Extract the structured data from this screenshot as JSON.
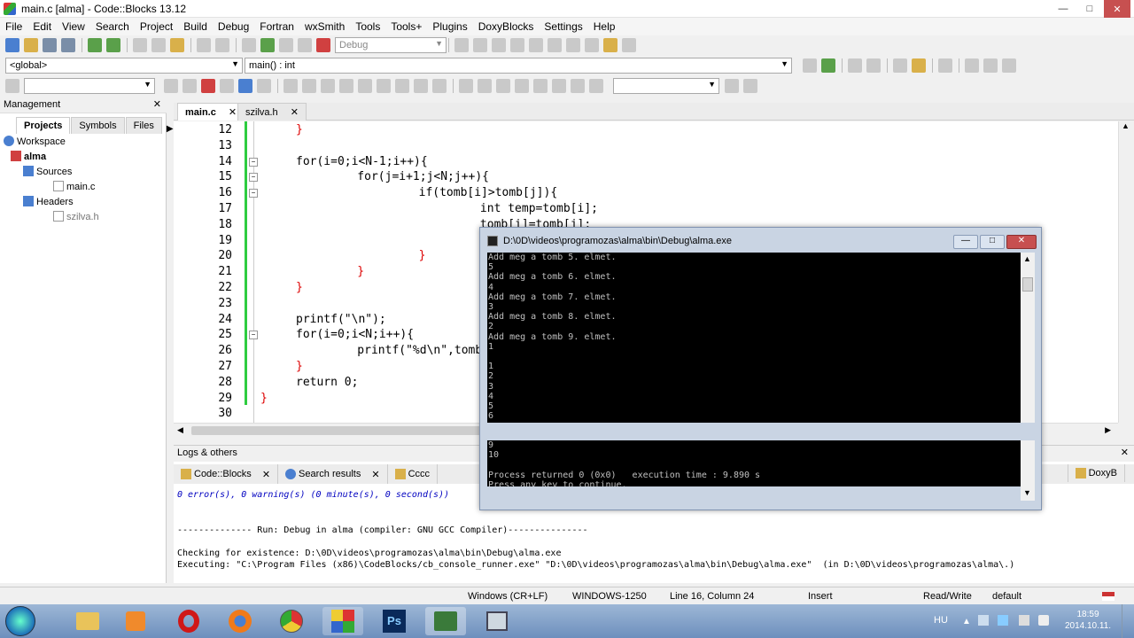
{
  "window": {
    "title": "main.c [alma] - Code::Blocks 13.12"
  },
  "menu": [
    "File",
    "Edit",
    "View",
    "Search",
    "Project",
    "Build",
    "Debug",
    "Fortran",
    "wxSmith",
    "Tools",
    "Tools+",
    "Plugins",
    "DoxyBlocks",
    "Settings",
    "Help"
  ],
  "toolbar": {
    "build_target": "Debug",
    "scope": "<global>",
    "function": "main() : int"
  },
  "management": {
    "title": "Management",
    "tabs": [
      "Projects",
      "Symbols",
      "Files"
    ],
    "tree": {
      "workspace": "Workspace",
      "project": "alma",
      "sources": "Sources",
      "source_file": "main.c",
      "headers": "Headers",
      "header_file": "szilva.h"
    }
  },
  "editor": {
    "tabs": [
      "main.c",
      "szilva.h"
    ],
    "line_numbers": [
      "12",
      "13",
      "14",
      "15",
      "16",
      "17",
      "18",
      "19",
      "20",
      "21",
      "22",
      "23",
      "24",
      "25",
      "26",
      "27",
      "28",
      "29",
      "30"
    ],
    "lines": [
      "}",
      "",
      "for(i=0;i<N-1;i++){",
      "    for(j=i+1;j<N;j++){",
      "        if(tomb[i]>tomb[j]){",
      "            int temp=tomb[i];",
      "            tomb[i]=tomb[j];",
      "            tomb[j]=ter",
      "        }",
      "    }",
      "}",
      "",
      "printf(\"\\n\");",
      "for(i=0;i<N;i++){",
      "    printf(\"%d\\n\",tomb",
      "}",
      "return 0;",
      "}",
      ""
    ]
  },
  "console": {
    "title": "D:\\0D\\videos\\programozas\\alma\\bin\\Debug\\alma.exe",
    "lines": [
      "Add meg a tomb 5. elmet.",
      "5",
      "Add meg a tomb 6. elmet.",
      "4",
      "Add meg a tomb 7. elmet.",
      "3",
      "Add meg a tomb 8. elmet.",
      "2",
      "Add meg a tomb 9. elmet.",
      "1",
      "",
      "1",
      "2",
      "3",
      "4",
      "5",
      "6"
    ],
    "lines2": [
      "9",
      "10",
      "",
      "Process returned 0 (0x0)   execution time : 9.890 s",
      "Press any key to continue."
    ]
  },
  "logs": {
    "title": "Logs & others",
    "tabs": [
      "Code::Blocks",
      "Search results",
      "Cccc",
      "DoxyB"
    ],
    "lines": [
      "0 error(s), 0 warning(s) (0 minute(s), 0 second(s))",
      "",
      "",
      "-------------- Run: Debug in alma (compiler: GNU GCC Compiler)---------------",
      "",
      "Checking for existence: D:\\0D\\videos\\programozas\\alma\\bin\\Debug\\alma.exe",
      "Executing: \"C:\\Program Files (x86)\\CodeBlocks/cb_console_runner.exe\" \"D:\\0D\\videos\\programozas\\alma\\bin\\Debug\\alma.exe\"  (in D:\\0D\\videos\\programozas\\alma\\.)"
    ]
  },
  "status": {
    "eol": "Windows (CR+LF)",
    "encoding": "WINDOWS-1250",
    "position": "Line 16, Column 24",
    "mode": "Insert",
    "access": "Read/Write",
    "lang": "default"
  },
  "taskbar": {
    "lang": "HU",
    "time": "18:59",
    "date": "2014.10.11."
  }
}
